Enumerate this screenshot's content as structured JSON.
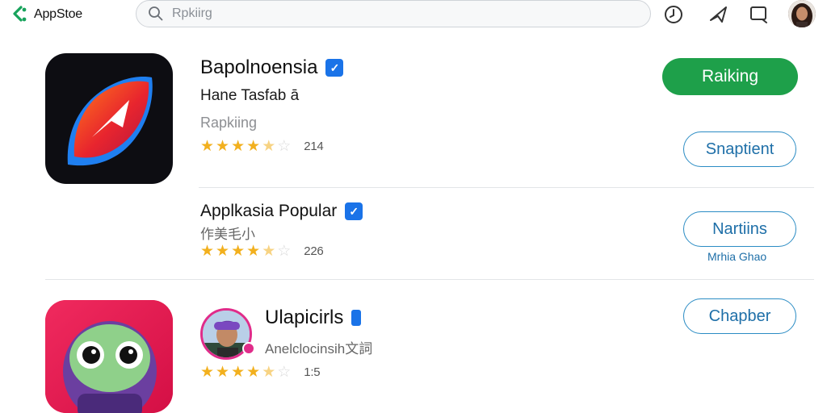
{
  "header": {
    "brand_name": "AppStoe",
    "search_placeholder": "Rpkiirg",
    "icons": [
      "clock-icon",
      "send-icon",
      "message-icon",
      "profile-avatar"
    ]
  },
  "apps": [
    {
      "title": "Bapolnoensia",
      "verified": true,
      "subtitle": "Hane Tasfab ā",
      "category": "Rapkiing",
      "rating": 4.5,
      "rating_count": "214",
      "primary_button": "Raiking",
      "secondary_button": "Snaptient"
    },
    {
      "title": "Applkasia Popular",
      "verified": true,
      "subtitle": "作美毛小",
      "rating": 4.5,
      "rating_count": "226",
      "button": "Nartiins",
      "link": "Mrhia Ghao"
    },
    {
      "title": "Ulapicirls",
      "subtitle": "Anelclocinsih文詞",
      "rating": 4.5,
      "rating_count": "1:5",
      "button": "Chapber"
    }
  ],
  "colors": {
    "primary_green": "#1ea04a",
    "outline_blue": "#2b8cc4",
    "star_gold": "#f2b01e",
    "verified_blue": "#1a73e8"
  }
}
